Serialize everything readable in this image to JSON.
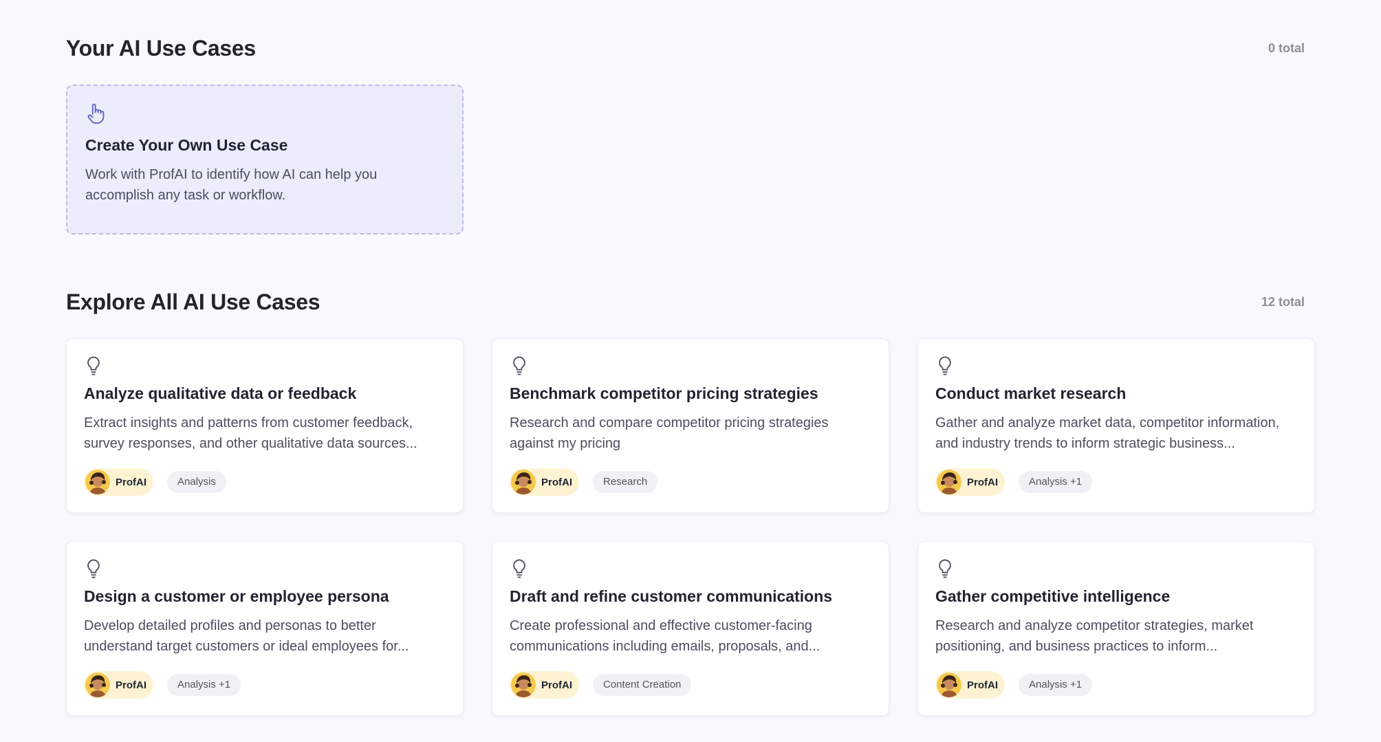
{
  "your_section": {
    "title": "Your AI Use Cases",
    "count": "0 total"
  },
  "create_card": {
    "icon": "hand-pointer-icon",
    "title": "Create Your Own Use Case",
    "description": "Work with ProfAI to identify how AI can help you accomplish any task or workflow."
  },
  "explore_section": {
    "title": "Explore All AI Use Cases",
    "count": "12 total"
  },
  "use_cases": [
    {
      "icon": "lightbulb-icon",
      "title": "Analyze qualitative data or feedback",
      "description": "Extract insights and patterns from customer feedback, survey responses, and other qualitative data sources...",
      "author": "ProfAI",
      "category": "Analysis"
    },
    {
      "icon": "lightbulb-icon",
      "title": "Benchmark competitor pricing strategies",
      "description": "Research and compare competitor pricing strategies against my pricing",
      "author": "ProfAI",
      "category": "Research"
    },
    {
      "icon": "lightbulb-icon",
      "title": "Conduct market research",
      "description": "Gather and analyze market data, competitor information, and industry trends to inform strategic business...",
      "author": "ProfAI",
      "category": "Analysis +1"
    },
    {
      "icon": "lightbulb-icon",
      "title": "Design a customer or employee persona",
      "description": "Develop detailed profiles and personas to better understand target customers or ideal employees for...",
      "author": "ProfAI",
      "category": "Analysis +1"
    },
    {
      "icon": "lightbulb-icon",
      "title": "Draft and refine customer communications",
      "description": "Create professional and effective customer-facing communications including emails, proposals, and...",
      "author": "ProfAI",
      "category": "Content Creation"
    },
    {
      "icon": "lightbulb-icon",
      "title": "Gather competitive intelligence",
      "description": "Research and analyze competitor strategies, market positioning, and business practices to inform...",
      "author": "ProfAI",
      "category": "Analysis +1"
    }
  ],
  "colors": {
    "background": "#f8f9fd",
    "create_card_bg": "#ebedfa",
    "create_card_border": "#b8bce6",
    "accent_icon": "#5a5fc4",
    "author_chip_bg": "#fdf3d3",
    "category_chip_bg": "#f0f1f4"
  }
}
